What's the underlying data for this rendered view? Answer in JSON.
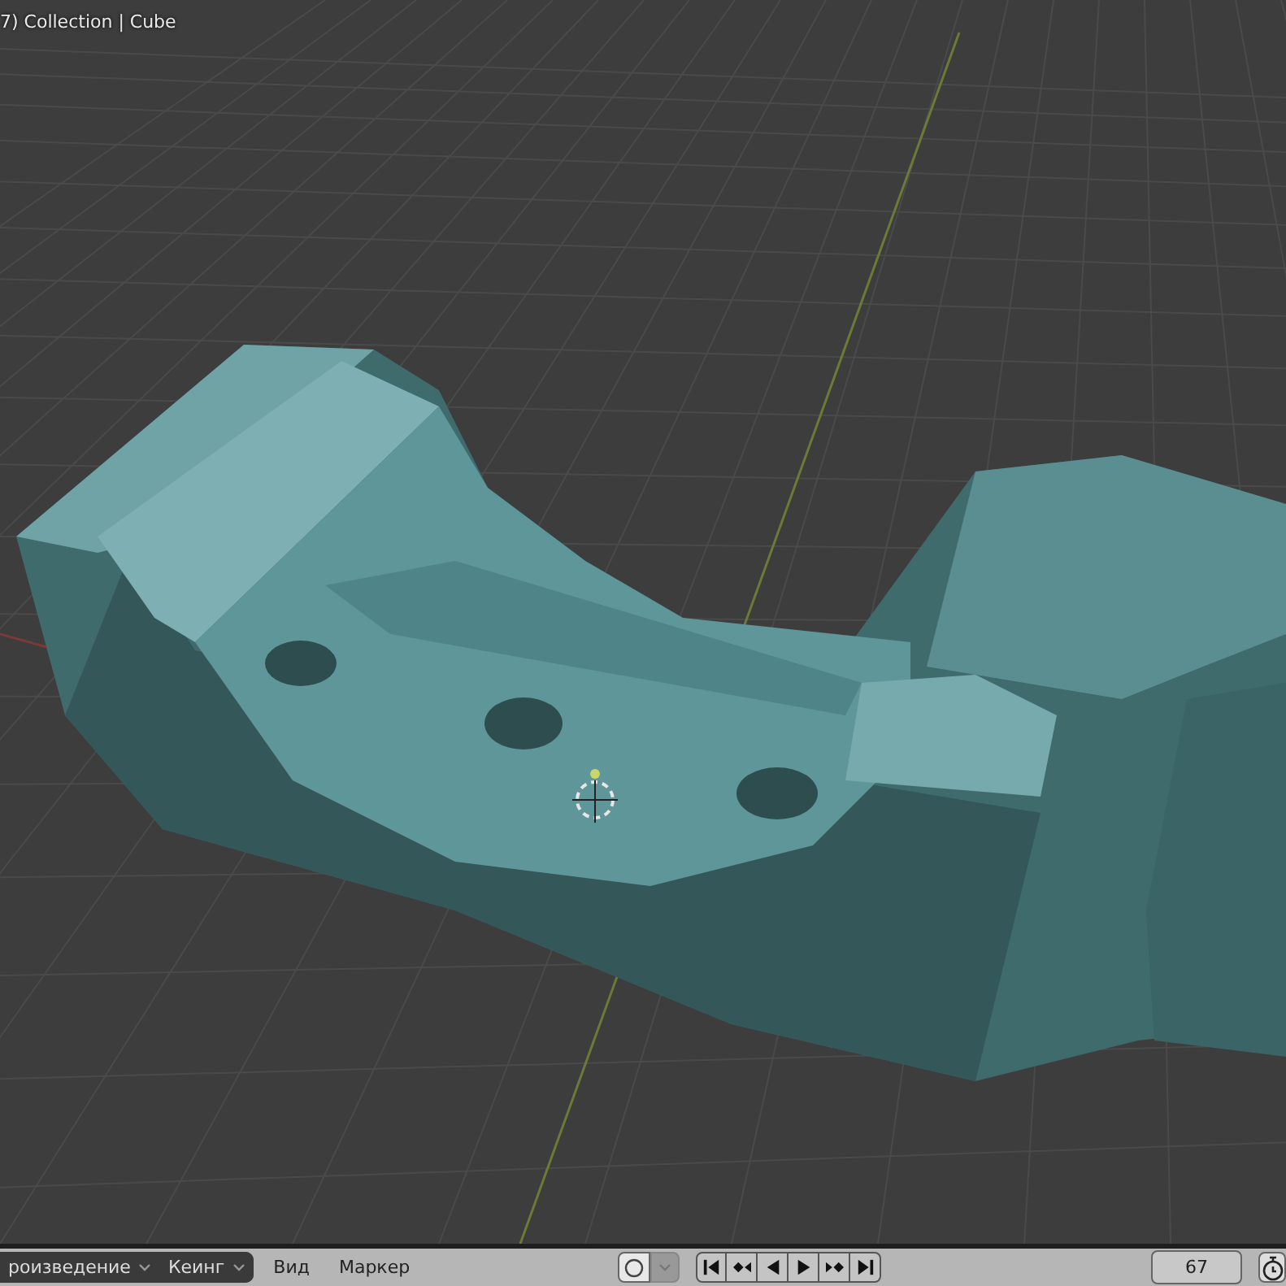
{
  "viewport": {
    "info": "7) Collection | Cube"
  },
  "timeline": {
    "menus": [
      {
        "label": "роизведение",
        "kind": "dropdown"
      },
      {
        "label": "Кеинг",
        "kind": "dropdown"
      },
      {
        "label": "Вид",
        "kind": "plain"
      },
      {
        "label": "Маркер",
        "kind": "plain"
      }
    ],
    "record": {
      "on": false
    },
    "current_frame": "67"
  }
}
